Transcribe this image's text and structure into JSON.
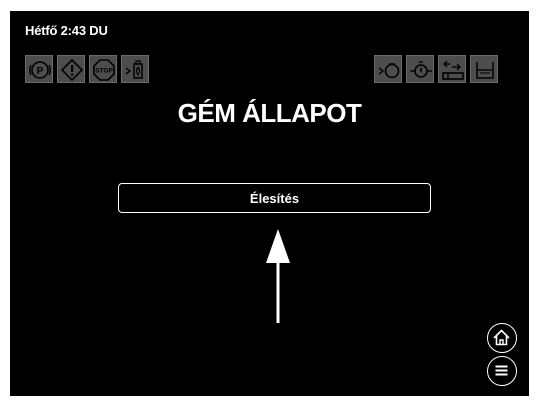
{
  "status_bar": {
    "clock": "Hétfő 2:43 DU",
    "left_icons": [
      {
        "icon": "parking-brake-icon"
      },
      {
        "icon": "warning-icon"
      },
      {
        "icon": "stop-icon"
      },
      {
        "icon": "fuel-icon"
      }
    ],
    "right_icons": [
      {
        "icon": "engine-icon"
      },
      {
        "icon": "oil-pressure-icon"
      },
      {
        "icon": "hydraulic-icon"
      },
      {
        "icon": "tank-icon"
      }
    ]
  },
  "page": {
    "title": "GÉM ÁLLAPOT",
    "main_button_label": "Élesítés"
  },
  "nav": {
    "home_icon": "home-icon",
    "menu_icon": "menu-icon"
  },
  "colors": {
    "screen_bg": "#000000",
    "icon_bg": "#4d4d4d",
    "text": "#ffffff"
  }
}
